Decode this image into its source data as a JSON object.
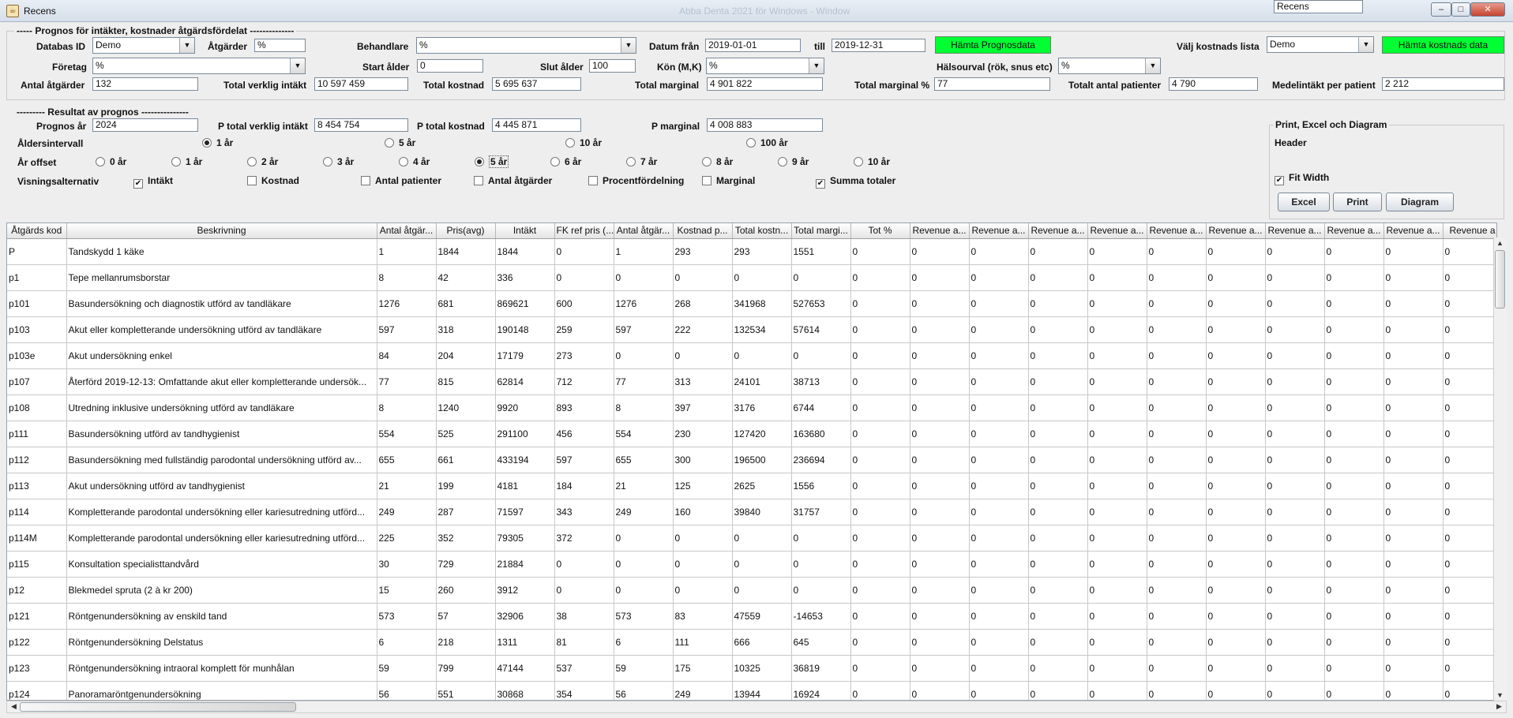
{
  "window": {
    "title": "Recens",
    "ghost_title": "Abba Denta 2021 för Windows - Window"
  },
  "prognos_section": {
    "legend": "----- Prognos för intäkter, kostnader åtgärdsfördelat  --------------"
  },
  "form": {
    "databas_id_label": "Databas ID",
    "databas_id_value": "Demo",
    "atgarder_label": "Åtgärder",
    "atgarder_value": "%",
    "behandlare_label": "Behandlare",
    "behandlare_value": "%",
    "datum_fran_label": "Datum från",
    "datum_fran_value": "2019-01-01",
    "till_label": "till",
    "till_value": "2019-12-31",
    "hamta_prognos_label": "Hämta Prognosdata",
    "valj_kostnads_label": "Välj kostnads lista",
    "valj_kostnads_value": "Demo",
    "hamta_kostnads_label": "Hämta kostnads data",
    "foretag_label": "Företag",
    "foretag_value": "%",
    "start_alder_label": "Start ålder",
    "start_alder_value": "0",
    "slut_alder_label": "Slut ålder",
    "slut_alder_value": "100",
    "kon_label": "Kön (M,K)",
    "kon_value": "%",
    "halsourval_label": "Hälsourval (rök, snus etc)",
    "halsourval_value": "%",
    "antal_atgarder_label": "Antal åtgärder",
    "antal_atgarder_value": "132",
    "total_verklig_label": "Total verklig intäkt",
    "total_verklig_value": "10 597 459",
    "total_kostnad_label": "Total kostnad",
    "total_kostnad_value": "5 695 637",
    "total_marginal_label": "Total marginal",
    "total_marginal_value": "4 901 822",
    "total_marginal_pct_label": "Total marginal %",
    "total_marginal_pct_value": "77",
    "totalt_antal_pat_label": "Totalt antal patienter",
    "totalt_antal_pat_value": "4 790",
    "medelintakt_label": "Medelintäkt per patient",
    "medelintakt_value": "2 212"
  },
  "resultat": {
    "legend": "---------  Resultat av prognos  ---------------",
    "prognos_ar_label": "Prognos år",
    "prognos_ar_value": "2024",
    "p_total_verklig_label": "P total verklig intäkt",
    "p_total_verklig_value": "8 454 754",
    "p_total_kostnad_label": "P total kostnad",
    "p_total_kostnad_value": "4 445 871",
    "p_marginal_label": "P marginal",
    "p_marginal_value": "4 008 883",
    "aldersintervall_label": "Åldersintervall",
    "aldersintervall_options": [
      "1 år",
      "5 år",
      "10 år",
      "100 år"
    ],
    "ar_offset_label": "År offset",
    "ar_offset_options": [
      "0 år",
      "1 år",
      "2 år",
      "3 år",
      "4 år",
      "5 år",
      "6 år",
      "7 år",
      "8 år",
      "9 år",
      "10 år"
    ],
    "visning_label": "Visningsalternativ",
    "visning_options": [
      {
        "label": "Intäkt",
        "checked": true
      },
      {
        "label": "Kostnad",
        "checked": false
      },
      {
        "label": "Antal patienter",
        "checked": false
      },
      {
        "label": "Antal åtgärder",
        "checked": false
      },
      {
        "label": "Procentfördelning",
        "checked": false
      },
      {
        "label": "Marginal",
        "checked": false
      },
      {
        "label": "Summa totaler",
        "checked": true
      }
    ]
  },
  "print_panel": {
    "title": "Print, Excel och Diagram",
    "header_label": "Header",
    "header_value": "Recens",
    "fit_width_label": "Fit Width",
    "excel_label": "Excel",
    "print_label": "Print",
    "diagram_label": "Diagram"
  },
  "table": {
    "headers": [
      "Åtgärds kod",
      "Beskrivning",
      "Antal åtgär...",
      "Pris(avg)",
      "Intäkt",
      "FK ref pris (...",
      "Antal åtgär...",
      "Kostnad p...",
      "Total kostn...",
      "Total margi...",
      "Tot %",
      "Revenue a...",
      "Revenue a...",
      "Revenue a...",
      "Revenue a...",
      "Revenue a...",
      "Revenue a...",
      "Revenue a...",
      "Revenue a...",
      "Revenue a...",
      "Revenue a"
    ],
    "rows": [
      [
        "P",
        "Tandskydd 1 käke",
        "1",
        "1844",
        "1844",
        "0",
        "1",
        "293",
        "293",
        "1551",
        "0",
        "0",
        "0",
        "0",
        "0",
        "0",
        "0",
        "0",
        "0",
        "0",
        "0"
      ],
      [
        "p1",
        "Tepe mellanrumsborstar",
        "8",
        "42",
        "336",
        "0",
        "0",
        "0",
        "0",
        "0",
        "0",
        "0",
        "0",
        "0",
        "0",
        "0",
        "0",
        "0",
        "0",
        "0",
        "0"
      ],
      [
        "p101",
        "Basundersökning och diagnostik utförd av tandläkare",
        "1276",
        "681",
        "869621",
        "600",
        "1276",
        "268",
        "341968",
        "527653",
        "0",
        "0",
        "0",
        "0",
        "0",
        "0",
        "0",
        "0",
        "0",
        "0",
        "0"
      ],
      [
        "p103",
        "Akut eller kompletterande undersökning  utförd av tandläkare",
        "597",
        "318",
        "190148",
        "259",
        "597",
        "222",
        "132534",
        "57614",
        "0",
        "0",
        "0",
        "0",
        "0",
        "0",
        "0",
        "0",
        "0",
        "0",
        "0"
      ],
      [
        "p103e",
        "Akut undersökning enkel",
        "84",
        "204",
        "17179",
        "273",
        "0",
        "0",
        "0",
        "0",
        "0",
        "0",
        "0",
        "0",
        "0",
        "0",
        "0",
        "0",
        "0",
        "0",
        "0"
      ],
      [
        "p107",
        "Återförd 2019-12-13: Omfattande akut eller kompletterande undersök...",
        "77",
        "815",
        "62814",
        "712",
        "77",
        "313",
        "24101",
        "38713",
        "0",
        "0",
        "0",
        "0",
        "0",
        "0",
        "0",
        "0",
        "0",
        "0",
        "0"
      ],
      [
        "p108",
        "Utredning inklusive undersökning  utförd av tandläkare",
        "8",
        "1240",
        "9920",
        "893",
        "8",
        "397",
        "3176",
        "6744",
        "0",
        "0",
        "0",
        "0",
        "0",
        "0",
        "0",
        "0",
        "0",
        "0",
        "0"
      ],
      [
        "p111",
        "Basundersökning  utförd av tandhygienist",
        "554",
        "525",
        "291100",
        "456",
        "554",
        "230",
        "127420",
        "163680",
        "0",
        "0",
        "0",
        "0",
        "0",
        "0",
        "0",
        "0",
        "0",
        "0",
        "0"
      ],
      [
        "p112",
        "Basundersökning med fullständig parodontal undersökning  utförd av...",
        "655",
        "661",
        "433194",
        "597",
        "655",
        "300",
        "196500",
        "236694",
        "0",
        "0",
        "0",
        "0",
        "0",
        "0",
        "0",
        "0",
        "0",
        "0",
        "0"
      ],
      [
        "p113",
        "Akut undersökning  utförd av tandhygienist",
        "21",
        "199",
        "4181",
        "184",
        "21",
        "125",
        "2625",
        "1556",
        "0",
        "0",
        "0",
        "0",
        "0",
        "0",
        "0",
        "0",
        "0",
        "0",
        "0"
      ],
      [
        "p114",
        "Kompletterande parodontal undersökning eller kariesutredning utförd...",
        "249",
        "287",
        "71597",
        "343",
        "249",
        "160",
        "39840",
        "31757",
        "0",
        "0",
        "0",
        "0",
        "0",
        "0",
        "0",
        "0",
        "0",
        "0",
        "0"
      ],
      [
        "p114M",
        "Kompletterande parodontal undersökning eller kariesutredning utförd...",
        "225",
        "352",
        "79305",
        "372",
        "0",
        "0",
        "0",
        "0",
        "0",
        "0",
        "0",
        "0",
        "0",
        "0",
        "0",
        "0",
        "0",
        "0",
        "0"
      ],
      [
        "p115",
        "Konsultation specialisttandvård",
        "30",
        "729",
        "21884",
        "0",
        "0",
        "0",
        "0",
        "0",
        "0",
        "0",
        "0",
        "0",
        "0",
        "0",
        "0",
        "0",
        "0",
        "0",
        "0"
      ],
      [
        "p12",
        "Blekmedel spruta  (2 à kr 200)",
        "15",
        "260",
        "3912",
        "0",
        "0",
        "0",
        "0",
        "0",
        "0",
        "0",
        "0",
        "0",
        "0",
        "0",
        "0",
        "0",
        "0",
        "0",
        "0"
      ],
      [
        "p121",
        "Röntgenundersökning av enskild tand",
        "573",
        "57",
        "32906",
        "38",
        "573",
        "83",
        "47559",
        "-14653",
        "0",
        "0",
        "0",
        "0",
        "0",
        "0",
        "0",
        "0",
        "0",
        "0",
        "0"
      ],
      [
        "p122",
        "Röntgenundersökning Delstatus",
        "6",
        "218",
        "1311",
        "81",
        "6",
        "111",
        "666",
        "645",
        "0",
        "0",
        "0",
        "0",
        "0",
        "0",
        "0",
        "0",
        "0",
        "0",
        "0"
      ],
      [
        "p123",
        "Röntgenundersökning  intraoral komplett för munhålan",
        "59",
        "799",
        "47144",
        "537",
        "59",
        "175",
        "10325",
        "36819",
        "0",
        "0",
        "0",
        "0",
        "0",
        "0",
        "0",
        "0",
        "0",
        "0",
        "0"
      ],
      [
        "p124",
        "Panoramaröntgenundersökning",
        "56",
        "551",
        "30868",
        "354",
        "56",
        "249",
        "13944",
        "16924",
        "0",
        "0",
        "0",
        "0",
        "0",
        "0",
        "0",
        "0",
        "0",
        "0",
        "0"
      ]
    ]
  },
  "colors": {
    "green_button": "#00ff33",
    "window_bg": "#eeeeee"
  }
}
